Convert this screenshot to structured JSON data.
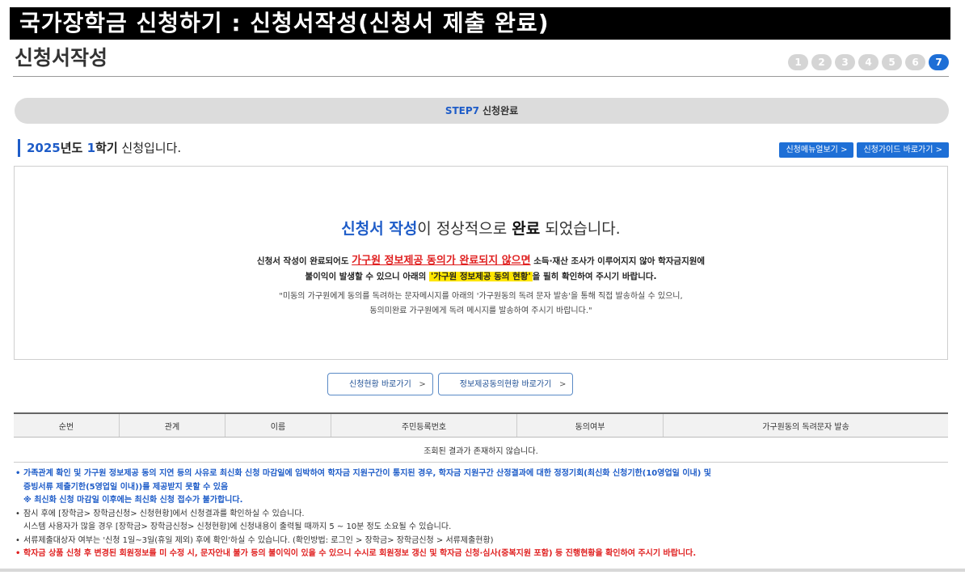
{
  "banner": {
    "title": "국가장학금 신청하기 : 신청서작성(신청서 제출 완료)"
  },
  "page": {
    "heading": "신청서작성"
  },
  "steps": {
    "items": [
      "1",
      "2",
      "3",
      "4",
      "5",
      "6",
      "7"
    ],
    "active": "7"
  },
  "step_bar": {
    "num": "STEP7",
    "label": "신청완료"
  },
  "year_line": {
    "year": "2025",
    "year_suffix": "년도 ",
    "term": "1",
    "term_suffix": "학기",
    "rest": " 신청입니다."
  },
  "top_buttons": {
    "manual": "신청메뉴얼보기 >",
    "guide": "신청가이드 바로가기 >"
  },
  "message": {
    "title_part1": "신청서 작성",
    "title_part2": "이 정상적으로 ",
    "title_part3": "완료",
    "title_part4": " 되었습니다.",
    "line1_a": "신청서 작성이 완료되어도 ",
    "line1_red": "가구원 정보제공 동의가 완료되지 않으면",
    "line1_b": " 소득·재산 조사가 이루어지지 않아 학자금지원에",
    "line2_a": "불이익이 발생할 수 있으니 아래의 ",
    "line2_yellow": "'가구원 정보제공 동의 현황'",
    "line2_b": "을 필히 확인하여 주시기 바랍니다.",
    "sub1": "\"미동의 가구원에게 동의를 독려하는 문자메시지를 아래의 '가구원동의 독려 문자 발송'을 통해 직접 발송하실 수 있으니,",
    "sub2": "동의미완료 가구원에게 독려 메시지를 발송하여 주시기 바랍니다.\""
  },
  "mid_buttons": {
    "status": "신청현황 바로가기",
    "consent": "정보제공동의현황 바로가기",
    "chevron": ">"
  },
  "table": {
    "headers": [
      "순번",
      "관계",
      "이름",
      "주민등록번호",
      "동의여부",
      "가구원동의 독려문자 발송"
    ],
    "empty_message": "조회된 결과가 존재하지 않습니다."
  },
  "notes": {
    "bullet": "•",
    "n1_line1": "가족관계 확인 및 가구원 정보제공 동의 지연 등의 사유로 최신화 신청 마감일에 임박하여 학자금 지원구간이 통지된 경우, 학자금 지원구간 산정결과에 대한 정정기회(최신화 신청기한(10영업일 이내) 및",
    "n1_line2": "증빙서류 제출기한(5영업일 이내))를 제공받지 못할 수 있음",
    "n1_line3": "※ 최신화 신청 마감일 이후에는 최신화 신청 접수가 불가합니다.",
    "n2_line1": "잠시 후에 [장학금> 장학금신청> 신청현황]에서 신청결과를 확인하실 수 있습니다.",
    "n2_line2": "시스템 사용자가 많을 경우 [장학금> 장학금신청> 신청현황]에 신청내용이 출력될 때까지 5 ~ 10분 정도 소요될 수 있습니다.",
    "n3": "서류제출대상자 여부는 '신청 1일~3일(휴일 제외) 후에 확인'하실 수 있습니다. (확인방법: 로그인 > 장학금> 장학금신청 > 서류제출현황)",
    "n4": "학자금 상품 신청 후 변경된 회원정보를 미 수정 시, 문자안내 불가 등의 불이익이 있을 수 있으니 수시로 회원정보 갱신 및 학자금 신청·심사(중복지원 포함) 등 진행현황을 확인하여 주시기 바랍니다."
  },
  "colors": {
    "accent": "#1e6fd6",
    "warning": "#e02020",
    "highlight": "#ffe600"
  }
}
